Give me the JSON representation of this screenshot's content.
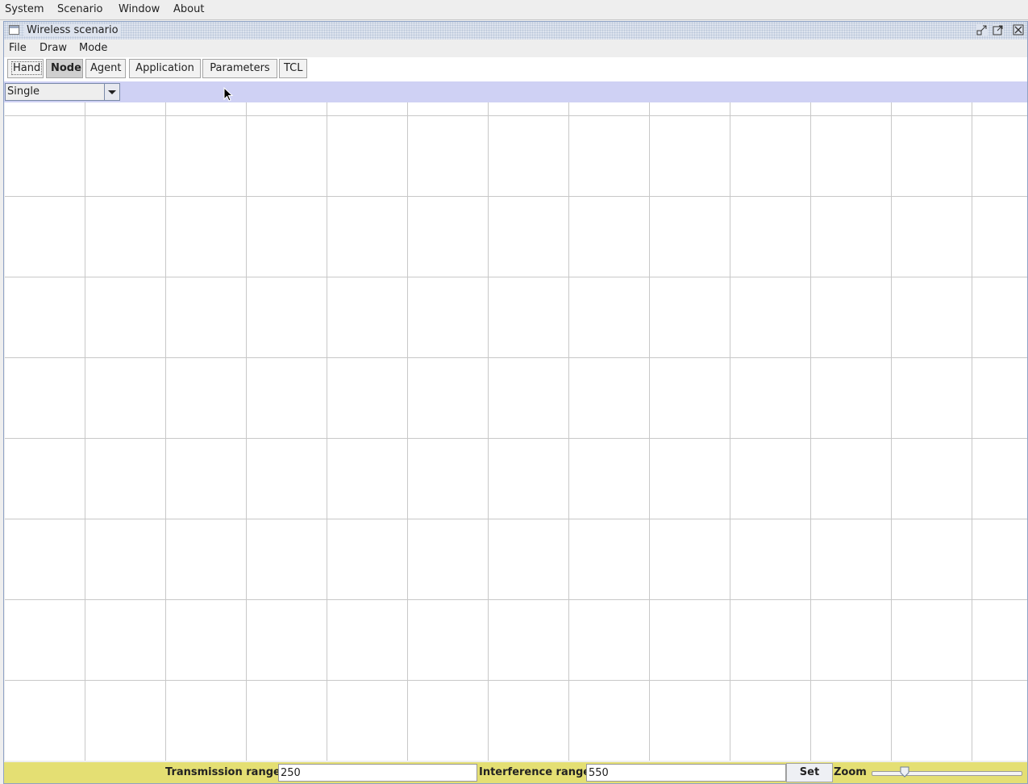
{
  "app_menu": [
    "System",
    "Scenario",
    "Window",
    "About"
  ],
  "window": {
    "title": "Wireless scenario",
    "controls": [
      "iconify-icon",
      "maximize-icon",
      "close-icon"
    ]
  },
  "window_menu": [
    "File",
    "Draw",
    "Mode"
  ],
  "toolbar": {
    "buttons": [
      "Hand",
      "Node",
      "Agent",
      "Application",
      "Parameters",
      "TCL"
    ],
    "selected": "Node"
  },
  "mode_select": {
    "value": "Single"
  },
  "status": {
    "transmission_label": "Transmission range",
    "transmission_value": "250",
    "interference_label": "Interference range",
    "interference_value": "550",
    "set_label": "Set",
    "zoom_label": "Zoom",
    "zoom_level": 0.2
  },
  "colors": {
    "mode_bar": "#cfd1f4",
    "status_bar": "#e4df73",
    "grid_line": "#c8c8c8"
  }
}
